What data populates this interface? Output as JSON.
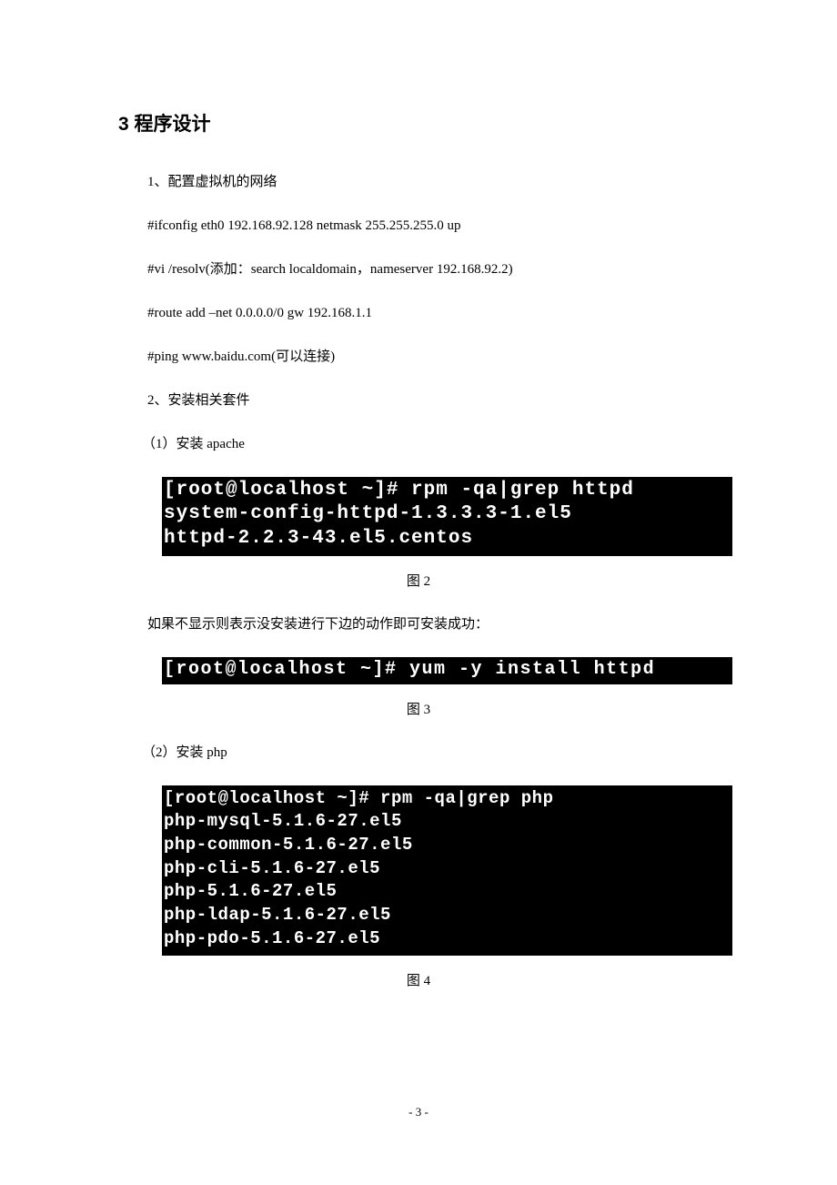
{
  "title": "3 程序设计",
  "lines": {
    "l1": "1、配置虚拟机的网络",
    "l2": "#ifconfig eth0 192.168.92.128 netmask 255.255.255.0 up",
    "l3": "#vi /resolv(添加：search localdomain，nameserver 192.168.92.2)",
    "l4": "#route add –net 0.0.0.0/0 gw 192.168.1.1",
    "l5": "#ping www.baidu.com(可以连接)",
    "l6": "2、安装相关套件",
    "l7": "（1）安装 apache",
    "l8": "如果不显示则表示没安装进行下边的动作即可安装成功：",
    "l9": "（2）安装 php"
  },
  "terminals": {
    "t1": "[root@localhost ~]# rpm -qa|grep httpd\nsystem-config-httpd-1.3.3.3-1.el5\nhttpd-2.2.3-43.el5.centos",
    "t2": "[root@localhost ~]# yum -y install httpd",
    "t3": "[root@localhost ~]# rpm -qa|grep php\nphp-mysql-5.1.6-27.el5\nphp-common-5.1.6-27.el5\nphp-cli-5.1.6-27.el5\nphp-5.1.6-27.el5\nphp-ldap-5.1.6-27.el5\nphp-pdo-5.1.6-27.el5"
  },
  "captions": {
    "c2": "图 2",
    "c3": "图 3",
    "c4": "图 4"
  },
  "pageNumber": "- 3 -"
}
